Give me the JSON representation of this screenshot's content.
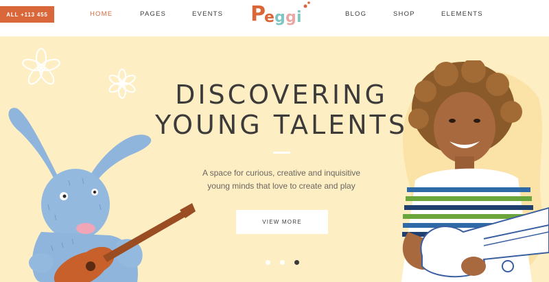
{
  "header": {
    "call_label": "ALL +113 455",
    "nav_left": [
      "HOME",
      "PAGES",
      "EVENTS"
    ],
    "nav_right": [
      "BLOG",
      "SHOP",
      "ELEMENTS"
    ],
    "active": "HOME",
    "logo_text": "Peggi"
  },
  "hero": {
    "title_line1": "DISCOVERING",
    "title_line2": "YOUNG TALENTS",
    "subtitle_line1": "A space for curious, creative and inquisitive",
    "subtitle_line2": "young minds that love to create and play",
    "button_label": "VIEW MORE",
    "slides_count": 3,
    "active_slide": 3
  },
  "colors": {
    "accent": "#d9673a",
    "hero_bg": "#fdeec4",
    "text_dark": "#3c3b3a"
  }
}
